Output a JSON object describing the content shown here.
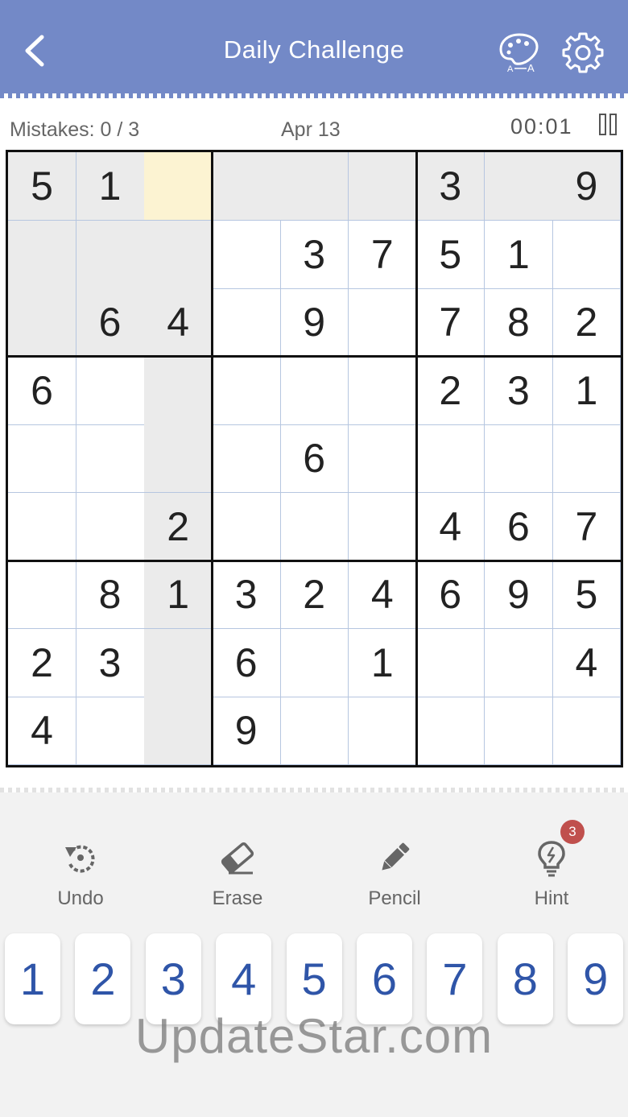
{
  "header": {
    "title": "Daily Challenge"
  },
  "status": {
    "mistakes": "Mistakes: 0 / 3",
    "date": "Apr 13",
    "timer": "00:01"
  },
  "board": {
    "grid": [
      [
        "5",
        "1",
        "",
        "",
        "",
        "",
        "3",
        "",
        "9"
      ],
      [
        "",
        "",
        "",
        "",
        "3",
        "7",
        "5",
        "1",
        ""
      ],
      [
        "",
        "6",
        "4",
        "",
        "9",
        "",
        "7",
        "8",
        "2"
      ],
      [
        "6",
        "",
        "",
        "",
        "",
        "",
        "2",
        "3",
        "1"
      ],
      [
        "",
        "",
        "",
        "",
        "6",
        "",
        "",
        "",
        ""
      ],
      [
        "",
        "",
        "2",
        "",
        "",
        "",
        "4",
        "6",
        "7"
      ],
      [
        "",
        "8",
        "1",
        "3",
        "2",
        "4",
        "6",
        "9",
        "5"
      ],
      [
        "2",
        "3",
        "",
        "6",
        "",
        "1",
        "",
        "",
        "4"
      ],
      [
        "4",
        "",
        "",
        "9",
        "",
        "",
        "",
        "",
        ""
      ]
    ],
    "selected": [
      0,
      2
    ],
    "colors": {
      "selected": "#fcf3d2",
      "highlight": "#ebebeb",
      "line": "#b6c6e0"
    }
  },
  "tools": {
    "undo": "Undo",
    "erase": "Erase",
    "pencil": "Pencil",
    "hint": "Hint",
    "hint_count": "3"
  },
  "numpad": [
    "1",
    "2",
    "3",
    "4",
    "5",
    "6",
    "7",
    "8",
    "9"
  ],
  "watermark": "UpdateStar.com",
  "icons": [
    "back-icon",
    "palette-icon",
    "gear-icon",
    "pause-icon",
    "undo-icon",
    "eraser-icon",
    "pencil-icon",
    "lightbulb-icon"
  ],
  "accent": "#7389c7",
  "digit_color": "#2f55a8"
}
